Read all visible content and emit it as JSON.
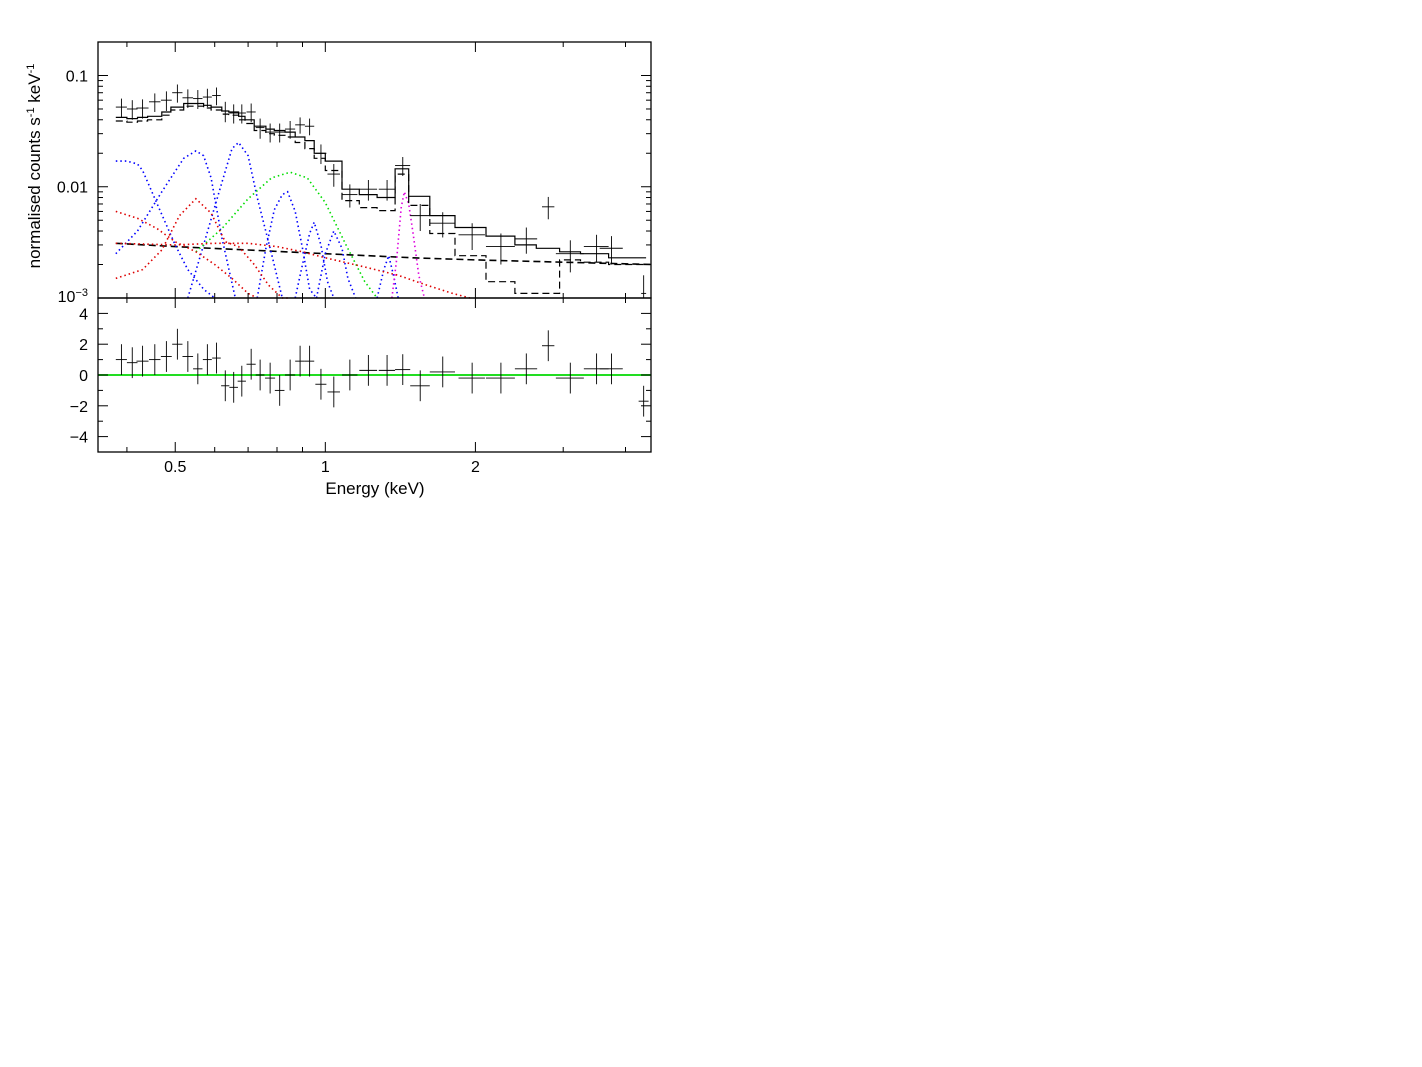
{
  "chart_data": [
    {
      "type": "line",
      "panel": "spectrum",
      "xlabel": "",
      "ylabel": "normalised counts s-1 keV-1",
      "ylabel_parts": {
        "base": "normalised counts s",
        "exp1": "-1",
        "mid": " keV",
        "exp2": "-1"
      },
      "xscale": "log",
      "yscale": "log",
      "xlim": [
        0.35,
        4.5
      ],
      "ylim": [
        0.001,
        0.2
      ],
      "yticks": [
        {
          "value": 0.1,
          "label": "0.1"
        },
        {
          "value": 0.01,
          "label": "0.01"
        },
        {
          "value": 0.001,
          "label": "10",
          "exp": "−3"
        }
      ],
      "data_points": [
        {
          "x": 0.39,
          "xerr": 0.01,
          "y": 0.052,
          "yerr": 0.01
        },
        {
          "x": 0.41,
          "xerr": 0.01,
          "y": 0.05,
          "yerr": 0.01
        },
        {
          "x": 0.43,
          "xerr": 0.012,
          "y": 0.051,
          "yerr": 0.01
        },
        {
          "x": 0.455,
          "xerr": 0.012,
          "y": 0.058,
          "yerr": 0.011
        },
        {
          "x": 0.48,
          "xerr": 0.012,
          "y": 0.06,
          "yerr": 0.012
        },
        {
          "x": 0.505,
          "xerr": 0.012,
          "y": 0.07,
          "yerr": 0.013
        },
        {
          "x": 0.53,
          "xerr": 0.013,
          "y": 0.063,
          "yerr": 0.012
        },
        {
          "x": 0.555,
          "xerr": 0.012,
          "y": 0.062,
          "yerr": 0.012
        },
        {
          "x": 0.58,
          "xerr": 0.012,
          "y": 0.064,
          "yerr": 0.012
        },
        {
          "x": 0.605,
          "xerr": 0.012,
          "y": 0.066,
          "yerr": 0.012
        },
        {
          "x": 0.63,
          "xerr": 0.012,
          "y": 0.048,
          "yerr": 0.01
        },
        {
          "x": 0.655,
          "xerr": 0.013,
          "y": 0.046,
          "yerr": 0.009
        },
        {
          "x": 0.68,
          "xerr": 0.013,
          "y": 0.046,
          "yerr": 0.009
        },
        {
          "x": 0.71,
          "xerr": 0.015,
          "y": 0.047,
          "yerr": 0.009
        },
        {
          "x": 0.74,
          "xerr": 0.015,
          "y": 0.034,
          "yerr": 0.007
        },
        {
          "x": 0.775,
          "xerr": 0.018,
          "y": 0.031,
          "yerr": 0.006
        },
        {
          "x": 0.81,
          "xerr": 0.018,
          "y": 0.031,
          "yerr": 0.006
        },
        {
          "x": 0.85,
          "xerr": 0.02,
          "y": 0.033,
          "yerr": 0.006
        },
        {
          "x": 0.89,
          "xerr": 0.02,
          "y": 0.036,
          "yerr": 0.006
        },
        {
          "x": 0.93,
          "xerr": 0.02,
          "y": 0.035,
          "yerr": 0.006
        },
        {
          "x": 0.98,
          "xerr": 0.025,
          "y": 0.02,
          "yerr": 0.004
        },
        {
          "x": 1.04,
          "xerr": 0.03,
          "y": 0.013,
          "yerr": 0.003
        },
        {
          "x": 1.12,
          "xerr": 0.04,
          "y": 0.0085,
          "yerr": 0.002
        },
        {
          "x": 1.22,
          "xerr": 0.05,
          "y": 0.0095,
          "yerr": 0.002
        },
        {
          "x": 1.33,
          "xerr": 0.05,
          "y": 0.0095,
          "yerr": 0.002
        },
        {
          "x": 1.43,
          "xerr": 0.05,
          "y": 0.0155,
          "yerr": 0.003
        },
        {
          "x": 1.55,
          "xerr": 0.07,
          "y": 0.0055,
          "yerr": 0.0015
        },
        {
          "x": 1.72,
          "xerr": 0.1,
          "y": 0.0047,
          "yerr": 0.0012
        },
        {
          "x": 1.97,
          "xerr": 0.12,
          "y": 0.0037,
          "yerr": 0.001
        },
        {
          "x": 2.25,
          "xerr": 0.15,
          "y": 0.0029,
          "yerr": 0.0009
        },
        {
          "x": 2.53,
          "xerr": 0.13,
          "y": 0.0034,
          "yerr": 0.0009
        },
        {
          "x": 2.8,
          "xerr": 0.08,
          "y": 0.0066,
          "yerr": 0.0015
        },
        {
          "x": 3.1,
          "xerr": 0.2,
          "y": 0.0025,
          "yerr": 0.0008
        },
        {
          "x": 3.5,
          "xerr": 0.2,
          "y": 0.0029,
          "yerr": 0.0008
        },
        {
          "x": 3.75,
          "xerr": 0.2,
          "y": 0.0028,
          "yerr": 0.0008
        },
        {
          "x": 4.35,
          "xerr": 0.05,
          "y": 0.0011,
          "yerr": 0.0005
        }
      ],
      "model_bin_edges": [
        0.38,
        0.4,
        0.42,
        0.44,
        0.47,
        0.49,
        0.52,
        0.54,
        0.57,
        0.59,
        0.62,
        0.64,
        0.67,
        0.69,
        0.72,
        0.76,
        0.79,
        0.83,
        0.87,
        0.91,
        0.95,
        1.0,
        1.08,
        1.17,
        1.27,
        1.38,
        1.47,
        1.62,
        1.82,
        2.1,
        2.4,
        2.65,
        2.95,
        3.25,
        3.7,
        4.4
      ],
      "total_model": [
        0.042,
        0.041,
        0.042,
        0.043,
        0.047,
        0.052,
        0.056,
        0.056,
        0.054,
        0.052,
        0.048,
        0.047,
        0.043,
        0.04,
        0.035,
        0.033,
        0.032,
        0.031,
        0.028,
        0.026,
        0.02,
        0.017,
        0.0095,
        0.0085,
        0.008,
        0.0145,
        0.0082,
        0.0055,
        0.0043,
        0.0036,
        0.003,
        0.0028,
        0.0026,
        0.0025,
        0.0023
      ],
      "dashed_model": [
        0.039,
        0.038,
        0.039,
        0.04,
        0.044,
        0.049,
        0.053,
        0.053,
        0.051,
        0.049,
        0.045,
        0.044,
        0.04,
        0.037,
        0.032,
        0.03,
        0.029,
        0.028,
        0.025,
        0.022,
        0.018,
        0.014,
        0.0075,
        0.0065,
        0.0061,
        0.013,
        0.0068,
        0.0038,
        0.0024,
        0.0014,
        0.0011,
        0.0011,
        0.0022,
        0.0021,
        0.002
      ],
      "components": [
        {
          "color": "#000000",
          "style": "dashed",
          "x": [
            0.38,
            0.5,
            0.7,
            1.0,
            1.5,
            2.0,
            3.0,
            4.5
          ],
          "y": [
            0.0031,
            0.0029,
            0.0027,
            0.0025,
            0.0023,
            0.0022,
            0.0021,
            0.002
          ]
        },
        {
          "color": "#0000ff",
          "style": "dotted",
          "x": [
            0.38,
            0.4,
            0.42,
            0.43,
            0.46,
            0.5,
            0.53,
            0.57,
            0.6
          ],
          "y": [
            0.017,
            0.017,
            0.016,
            0.014,
            0.007,
            0.003,
            0.0018,
            0.0012,
            0.001
          ]
        },
        {
          "color": "#0000ff",
          "style": "dotted",
          "x": [
            0.38,
            0.42,
            0.47,
            0.52,
            0.55,
            0.57,
            0.59,
            0.62,
            0.66
          ],
          "y": [
            0.0025,
            0.004,
            0.009,
            0.018,
            0.021,
            0.019,
            0.012,
            0.0035,
            0.001
          ]
        },
        {
          "color": "#0000ff",
          "style": "dotted",
          "x": [
            0.53,
            0.57,
            0.61,
            0.65,
            0.67,
            0.7,
            0.73,
            0.78,
            0.82
          ],
          "y": [
            0.001,
            0.003,
            0.0085,
            0.022,
            0.025,
            0.019,
            0.008,
            0.0025,
            0.001
          ]
        },
        {
          "color": "#0000ff",
          "style": "dotted",
          "x": [
            0.73,
            0.76,
            0.79,
            0.82,
            0.84,
            0.87,
            0.9,
            0.93,
            0.96
          ],
          "y": [
            0.001,
            0.0028,
            0.0062,
            0.0085,
            0.009,
            0.006,
            0.0028,
            0.0012,
            0.001
          ]
        },
        {
          "color": "#0000ff",
          "style": "dotted",
          "x": [
            0.87,
            0.9,
            0.93,
            0.95,
            0.98,
            1.01,
            1.04
          ],
          "y": [
            0.001,
            0.002,
            0.0038,
            0.0048,
            0.003,
            0.0014,
            0.001
          ]
        },
        {
          "color": "#0000ff",
          "style": "dotted",
          "x": [
            0.96,
            1.0,
            1.04,
            1.08,
            1.11,
            1.15
          ],
          "y": [
            0.001,
            0.0025,
            0.004,
            0.0028,
            0.0015,
            0.001
          ]
        },
        {
          "color": "#0000ff",
          "style": "dotted",
          "x": [
            1.27,
            1.31,
            1.34,
            1.37,
            1.4
          ],
          "y": [
            0.001,
            0.0018,
            0.0024,
            0.0016,
            0.001
          ]
        },
        {
          "color": "#00dd00",
          "style": "dotted",
          "x": [
            0.55,
            0.62,
            0.7,
            0.78,
            0.85,
            0.92,
            1.0,
            1.1,
            1.2,
            1.27
          ],
          "y": [
            0.0026,
            0.0042,
            0.0078,
            0.012,
            0.0135,
            0.012,
            0.0072,
            0.003,
            0.0014,
            0.001
          ]
        },
        {
          "color": "#dd0000",
          "style": "dotted",
          "x": [
            0.38,
            0.43,
            0.47,
            0.51,
            0.55,
            0.59,
            0.63,
            0.67,
            0.72,
            0.77,
            0.82,
            0.85
          ],
          "y": [
            0.0015,
            0.0018,
            0.0027,
            0.0055,
            0.0078,
            0.0058,
            0.0032,
            0.0029,
            0.002,
            0.0013,
            0.001,
            0.001
          ]
        },
        {
          "color": "#dd0000",
          "style": "dotted",
          "x": [
            0.38,
            0.42,
            0.46,
            0.5,
            0.55,
            0.6,
            0.65,
            0.7,
            0.73
          ],
          "y": [
            0.006,
            0.0052,
            0.0042,
            0.0032,
            0.0026,
            0.002,
            0.0015,
            0.0011,
            0.001
          ]
        },
        {
          "color": "#dd0000",
          "style": "dotted",
          "x": [
            0.38,
            0.5,
            0.6,
            0.7,
            0.8,
            0.9,
            1.0,
            1.2,
            1.4,
            1.6,
            1.8,
            1.95
          ],
          "y": [
            0.0031,
            0.003,
            0.0031,
            0.0031,
            0.0029,
            0.0026,
            0.0023,
            0.0019,
            0.0016,
            0.0013,
            0.0011,
            0.001
          ]
        },
        {
          "color": "#dd00dd",
          "style": "dotted",
          "x": [
            1.36,
            1.39,
            1.42,
            1.44,
            1.47,
            1.5,
            1.54,
            1.58
          ],
          "y": [
            0.001,
            0.0022,
            0.0065,
            0.009,
            0.007,
            0.0038,
            0.0016,
            0.001
          ]
        }
      ]
    },
    {
      "type": "scatter",
      "panel": "residuals",
      "xlabel": "Energy (keV)",
      "ylabel": "",
      "xscale": "log",
      "xlim": [
        0.35,
        4.5
      ],
      "ylim": [
        -5,
        5
      ],
      "xticks": [
        {
          "value": 0.5,
          "label": "0.5"
        },
        {
          "value": 1,
          "label": "1"
        },
        {
          "value": 2,
          "label": "2"
        }
      ],
      "yticks": [
        {
          "value": 4,
          "label": "4"
        },
        {
          "value": 2,
          "label": "2"
        },
        {
          "value": 0,
          "label": "0"
        },
        {
          "value": -2,
          "label": "−2"
        },
        {
          "value": -4,
          "label": "−4"
        }
      ],
      "zero_line_color": "#22dd22",
      "points": [
        {
          "x": 0.39,
          "xerr": 0.01,
          "y": 1.0,
          "yerr": 1.0
        },
        {
          "x": 0.41,
          "xerr": 0.01,
          "y": 0.8,
          "yerr": 1.0
        },
        {
          "x": 0.43,
          "xerr": 0.012,
          "y": 0.9,
          "yerr": 1.0
        },
        {
          "x": 0.455,
          "xerr": 0.012,
          "y": 1.0,
          "yerr": 1.0
        },
        {
          "x": 0.48,
          "xerr": 0.012,
          "y": 1.2,
          "yerr": 1.0
        },
        {
          "x": 0.505,
          "xerr": 0.012,
          "y": 2.0,
          "yerr": 1.0
        },
        {
          "x": 0.53,
          "xerr": 0.013,
          "y": 1.2,
          "yerr": 1.0
        },
        {
          "x": 0.555,
          "xerr": 0.012,
          "y": 0.4,
          "yerr": 1.0
        },
        {
          "x": 0.58,
          "xerr": 0.012,
          "y": 1.0,
          "yerr": 1.0
        },
        {
          "x": 0.605,
          "xerr": 0.012,
          "y": 1.1,
          "yerr": 1.0
        },
        {
          "x": 0.63,
          "xerr": 0.012,
          "y": -0.7,
          "yerr": 1.0
        },
        {
          "x": 0.655,
          "xerr": 0.013,
          "y": -0.8,
          "yerr": 1.0
        },
        {
          "x": 0.68,
          "xerr": 0.013,
          "y": -0.4,
          "yerr": 1.0
        },
        {
          "x": 0.71,
          "xerr": 0.015,
          "y": 0.7,
          "yerr": 1.0
        },
        {
          "x": 0.74,
          "xerr": 0.015,
          "y": 0.0,
          "yerr": 1.0
        },
        {
          "x": 0.775,
          "xerr": 0.018,
          "y": -0.2,
          "yerr": 1.0
        },
        {
          "x": 0.81,
          "xerr": 0.018,
          "y": -1.0,
          "yerr": 1.0
        },
        {
          "x": 0.85,
          "xerr": 0.02,
          "y": 0.0,
          "yerr": 1.0
        },
        {
          "x": 0.89,
          "xerr": 0.02,
          "y": 0.9,
          "yerr": 1.0
        },
        {
          "x": 0.93,
          "xerr": 0.02,
          "y": 0.9,
          "yerr": 1.0
        },
        {
          "x": 0.98,
          "xerr": 0.025,
          "y": -0.6,
          "yerr": 1.0
        },
        {
          "x": 1.04,
          "xerr": 0.03,
          "y": -1.1,
          "yerr": 1.0
        },
        {
          "x": 1.12,
          "xerr": 0.04,
          "y": 0.0,
          "yerr": 1.0
        },
        {
          "x": 1.22,
          "xerr": 0.05,
          "y": 0.3,
          "yerr": 1.0
        },
        {
          "x": 1.33,
          "xerr": 0.05,
          "y": 0.3,
          "yerr": 1.0
        },
        {
          "x": 1.43,
          "xerr": 0.05,
          "y": 0.35,
          "yerr": 1.0
        },
        {
          "x": 1.55,
          "xerr": 0.07,
          "y": -0.7,
          "yerr": 1.0
        },
        {
          "x": 1.72,
          "xerr": 0.1,
          "y": 0.2,
          "yerr": 1.0
        },
        {
          "x": 1.97,
          "xerr": 0.12,
          "y": -0.2,
          "yerr": 1.0
        },
        {
          "x": 2.25,
          "xerr": 0.15,
          "y": -0.2,
          "yerr": 1.0
        },
        {
          "x": 2.53,
          "xerr": 0.13,
          "y": 0.4,
          "yerr": 1.0
        },
        {
          "x": 2.8,
          "xerr": 0.08,
          "y": 1.9,
          "yerr": 1.0
        },
        {
          "x": 3.1,
          "xerr": 0.2,
          "y": -0.2,
          "yerr": 1.0
        },
        {
          "x": 3.5,
          "xerr": 0.2,
          "y": 0.4,
          "yerr": 1.0
        },
        {
          "x": 3.75,
          "xerr": 0.2,
          "y": 0.4,
          "yerr": 1.0
        },
        {
          "x": 4.35,
          "xerr": 0.1,
          "y": -1.7,
          "yerr": 1.0
        }
      ]
    }
  ]
}
